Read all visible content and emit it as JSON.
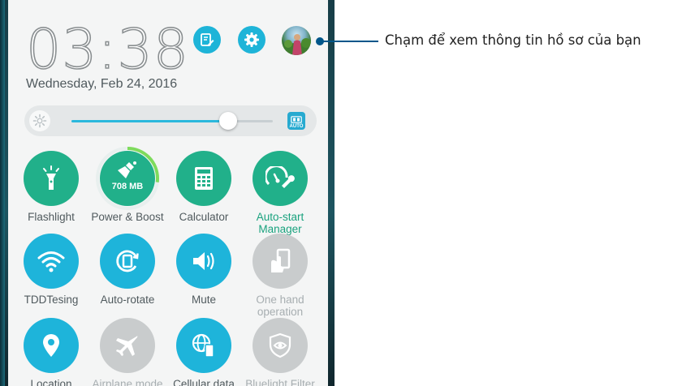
{
  "clock": {
    "time": "03:38",
    "date": "Wednesday, Feb 24, 2016"
  },
  "header": {
    "note_icon": "edit-note-icon",
    "settings_icon": "gear-icon",
    "avatar_icon": "profile-avatar"
  },
  "brightness": {
    "level": 0.78,
    "auto_label": "AUTO"
  },
  "tiles": {
    "flashlight": {
      "label": "Flashlight",
      "icon": "flashlight-icon",
      "on": true
    },
    "boost": {
      "label": "Power & Boost",
      "value": "708 MB",
      "icon": "broom-icon",
      "ring_fraction": 0.27,
      "on": true
    },
    "calculator": {
      "label": "Calculator",
      "icon": "calculator-icon",
      "on": true
    },
    "autostart": {
      "label": "Auto-start Manager",
      "icon": "speedometer-wrench-icon",
      "on": true
    },
    "wifi": {
      "label": "TDDTesing",
      "icon": "wifi-icon",
      "on": true
    },
    "rotate": {
      "label": "Auto-rotate",
      "icon": "auto-rotate-icon",
      "on": true
    },
    "mute": {
      "label": "Mute",
      "icon": "speaker-vibrate-icon",
      "on": true
    },
    "onehand": {
      "label": "One hand operation",
      "icon": "one-hand-icon",
      "on": false
    },
    "location": {
      "label": "Location",
      "icon": "location-pin-icon",
      "on": true
    },
    "airplane": {
      "label": "Airplane mode",
      "icon": "airplane-icon",
      "on": false
    },
    "cellular": {
      "label": "Cellular data",
      "icon": "globe-phone-icon",
      "on": true
    },
    "bluelight": {
      "label": "Bluelight Filter",
      "icon": "eye-shield-icon",
      "on": false
    }
  },
  "callout": {
    "text": "Chạm để xem thông tin hồ sơ của bạn"
  },
  "colors": {
    "accent_blue": "#1eb4da",
    "accent_green": "#21b08a",
    "disabled_grey": "#c9cccd",
    "callout_line": "#00568a"
  }
}
